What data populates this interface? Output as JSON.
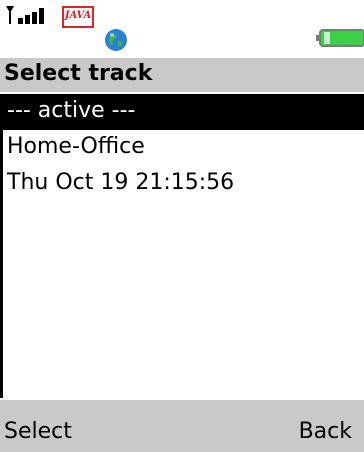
{
  "status_bar": {
    "icons": [
      "signal-icon",
      "java-icon",
      "globe-icon",
      "battery-icon"
    ],
    "java_label": "JAVA"
  },
  "title": "Select track",
  "list": {
    "items": [
      {
        "label": "--- active ---",
        "selected": true
      },
      {
        "label": "Home-Office",
        "selected": false
      },
      {
        "label": "Thu Oct  19 21:15:56",
        "selected": false
      }
    ]
  },
  "softkeys": {
    "left": "Select",
    "right": "Back"
  },
  "colors": {
    "title_bar": "#c9c9c9",
    "softkey_bar": "#c9c9c9",
    "selected_bg": "#000000",
    "selected_text": "#ffffff",
    "java_red": "#d7262c",
    "battery_green": "#3bd24a"
  }
}
